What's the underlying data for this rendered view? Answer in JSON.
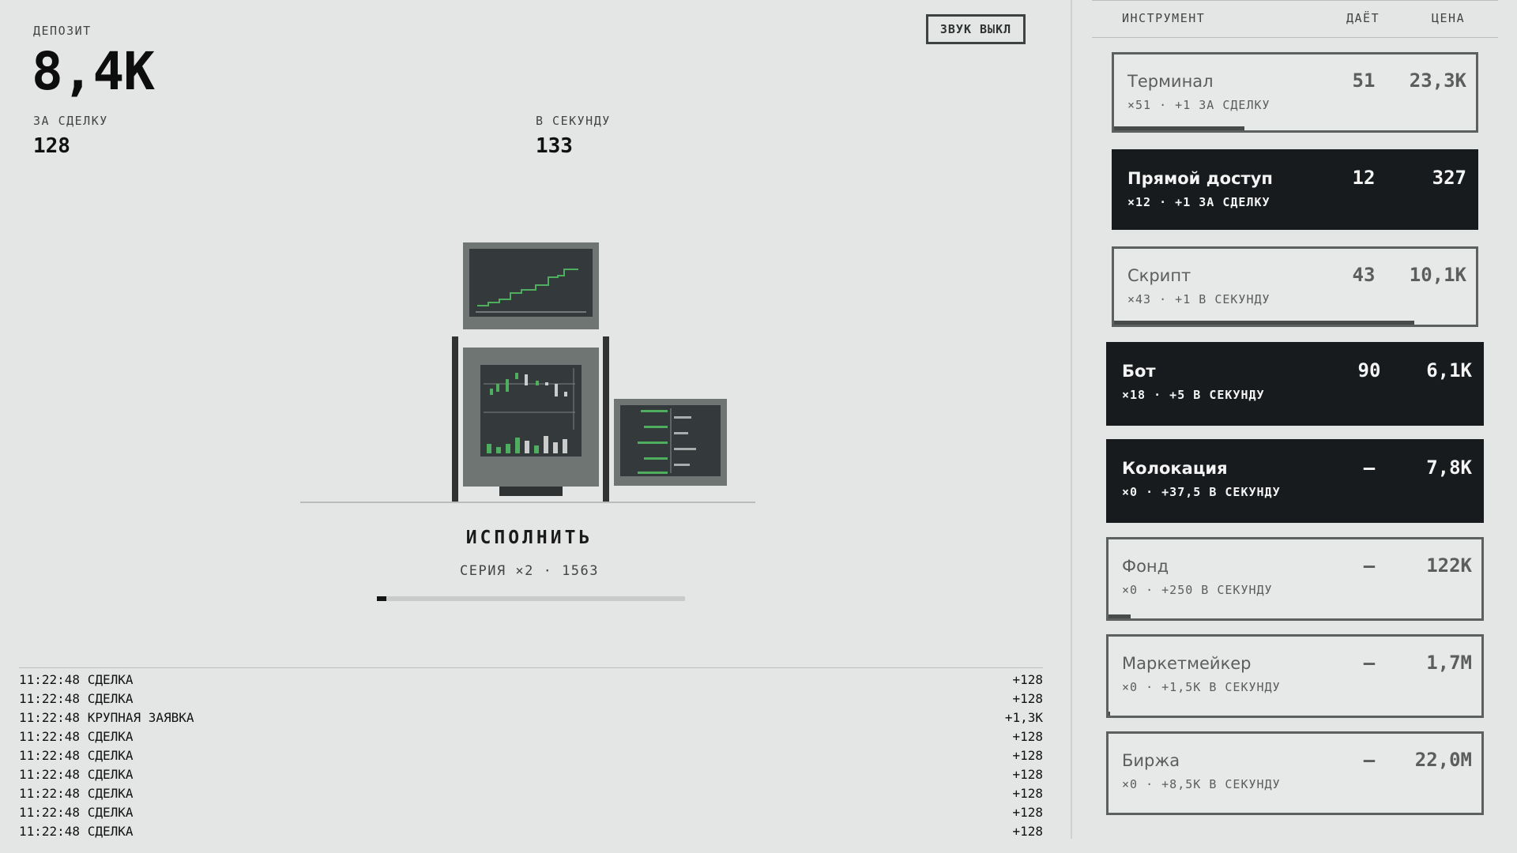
{
  "stats": {
    "deposit_label": "ДЕПОЗИТ",
    "deposit_value": "8,4К",
    "per_trade_label": "ЗА СДЕЛКУ",
    "per_trade_value": "128",
    "per_second_label": "В СЕКУНДУ",
    "per_second_value": "133"
  },
  "sound_button_label": "ЗВУК ВЫКЛ",
  "execute": {
    "label": "ИСПОЛНИТЬ",
    "streak": "СЕРИЯ ×2 · 1563",
    "progress": 0.03
  },
  "log": [
    {
      "text": "11:22:48 СДЕЛКА",
      "amount": "+128"
    },
    {
      "text": "11:22:48 СДЕЛКА",
      "amount": "+128"
    },
    {
      "text": "11:22:48 КРУПНАЯ ЗАЯВКА",
      "amount": "+1,3К"
    },
    {
      "text": "11:22:48 СДЕЛКА",
      "amount": "+128"
    },
    {
      "text": "11:22:48 СДЕЛКА",
      "amount": "+128"
    },
    {
      "text": "11:22:48 СДЕЛКА",
      "amount": "+128"
    },
    {
      "text": "11:22:48 СДЕЛКА",
      "amount": "+128"
    },
    {
      "text": "11:22:48 СДЕЛКА",
      "amount": "+128"
    },
    {
      "text": "11:22:48 СДЕЛКА",
      "amount": "+128"
    }
  ],
  "shop": {
    "header": {
      "instrument": "ИНСТРУМЕНТ",
      "gives": "ДАЁТ",
      "price": "ЦЕНА"
    },
    "items": [
      {
        "name": "Терминал",
        "sub": "×51 · +1 ЗА СДЕЛКУ",
        "gives": "51",
        "price": "23,3К",
        "affordable": false,
        "progress": 0.36
      },
      {
        "name": "Прямой доступ",
        "sub": "×12 · +1 ЗА СДЕЛКУ",
        "gives": "12",
        "price": "327",
        "affordable": true,
        "progress": 0
      },
      {
        "name": "Скрипт",
        "sub": "×43 · +1 В СЕКУНДУ",
        "gives": "43",
        "price": "10,1К",
        "affordable": false,
        "progress": 0.83
      },
      {
        "name": "Бот",
        "sub": "×18 · +5 В СЕКУНДУ",
        "gives": "90",
        "price": "6,1К",
        "affordable": true,
        "progress": 0
      },
      {
        "name": "Колокация",
        "sub": "×0 · +37,5 В СЕКУНДУ",
        "gives": "—",
        "price": "7,8К",
        "affordable": true,
        "progress": 0
      },
      {
        "name": "Фонд",
        "sub": "×0 · +250 В СЕКУНДУ",
        "gives": "—",
        "price": "122К",
        "affordable": false,
        "progress": 0.06
      },
      {
        "name": "Маркетмейкер",
        "sub": "×0 · +1,5К В СЕКУНДУ",
        "gives": "—",
        "price": "1,7М",
        "affordable": false,
        "progress": 0.005
      },
      {
        "name": "Биржа",
        "sub": "×0 · +8,5К В СЕКУНДУ",
        "gives": "—",
        "price": "22,0М",
        "affordable": false,
        "progress": 0
      }
    ]
  },
  "colors": {
    "background": "#e4e6e5",
    "card_dark": "#171b1d",
    "accent_green": "#3d9a50",
    "screen_dark": "#343a3b"
  }
}
